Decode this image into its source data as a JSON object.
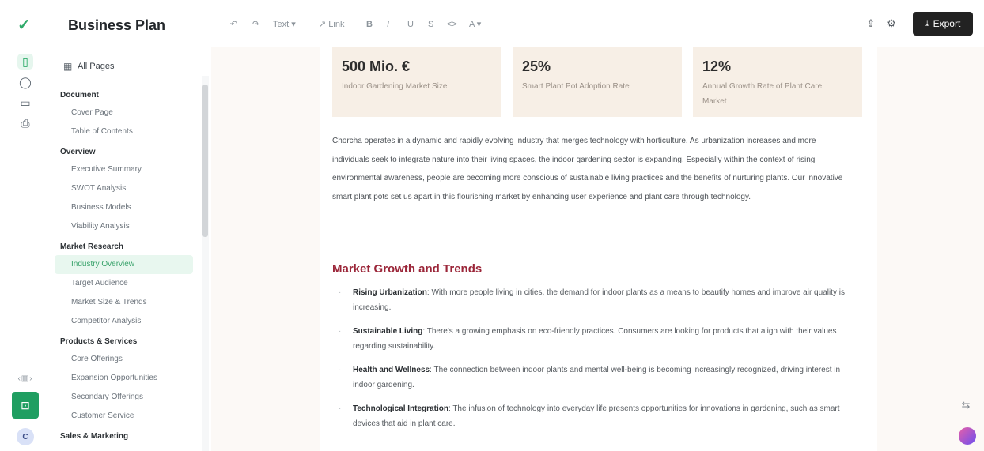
{
  "app": {
    "logo_glyph": "✓",
    "rail_icons": [
      "document-icon",
      "chat-icon",
      "monitor-icon",
      "print-icon"
    ],
    "avatar_initial": "C",
    "colors": {
      "brand": "#1f9e61",
      "heading": "#9b2639",
      "stat_bg": "#f7efe6"
    }
  },
  "sidebar": {
    "title": "Business Plan",
    "all_pages": "All Pages",
    "sections": [
      {
        "name": "Document",
        "items": [
          "Cover Page",
          "Table of Contents"
        ]
      },
      {
        "name": "Overview",
        "items": [
          "Executive Summary",
          "SWOT Analysis",
          "Business Models",
          "Viability Analysis"
        ]
      },
      {
        "name": "Market Research",
        "items": [
          "Industry Overview",
          "Target Audience",
          "Market Size & Trends",
          "Competitor Analysis"
        ]
      },
      {
        "name": "Products & Services",
        "items": [
          "Core Offerings",
          "Expansion Opportunities",
          "Secondary Offerings",
          "Customer Service"
        ]
      },
      {
        "name": "Sales & Marketing",
        "items": []
      }
    ],
    "active_item": "Industry Overview"
  },
  "toolbar": {
    "undo": "↶",
    "redo": "↷",
    "text_menu": "Text ▾",
    "link": "↗ Link",
    "bold": "B",
    "italic": "I",
    "underline": "U",
    "strike": "S",
    "code": "<>",
    "color_menu": "A ▾",
    "export_label": "Export"
  },
  "content": {
    "stats": [
      {
        "value": "500 Mio. €",
        "label": "Indoor Gardening Market Size"
      },
      {
        "value": "25%",
        "label": "Smart Plant Pot Adoption Rate"
      },
      {
        "value": "12%",
        "label": "Annual Growth Rate of Plant Care Market"
      }
    ],
    "paragraph": "Chorcha operates in a dynamic and rapidly evolving industry that merges technology with horticulture. As urbanization increases and more individuals seek to integrate nature into their living spaces, the indoor gardening sector is expanding. Especially within the context of rising environmental awareness, people are becoming more conscious of sustainable living practices and the benefits of nurturing plants. Our innovative smart plant pots set us apart in this flourishing market by enhancing user experience and plant care through technology.",
    "heading": "Market Growth and Trends",
    "bullets": [
      {
        "term": "Rising Urbanization",
        "text": ": With more people living in cities, the demand for indoor plants as a means to beautify homes and improve air quality is increasing."
      },
      {
        "term": "Sustainable Living",
        "text": ": There's a growing emphasis on eco-friendly practices. Consumers are looking for products that align with their values regarding sustainability."
      },
      {
        "term": "Health and Wellness",
        "text": ": The connection between indoor plants and mental well-being is becoming increasingly recognized, driving interest in indoor gardening."
      },
      {
        "term": "Technological Integration",
        "text": ": The infusion of technology into everyday life presents opportunities for innovations in gardening, such as smart devices that aid in plant care."
      }
    ]
  }
}
